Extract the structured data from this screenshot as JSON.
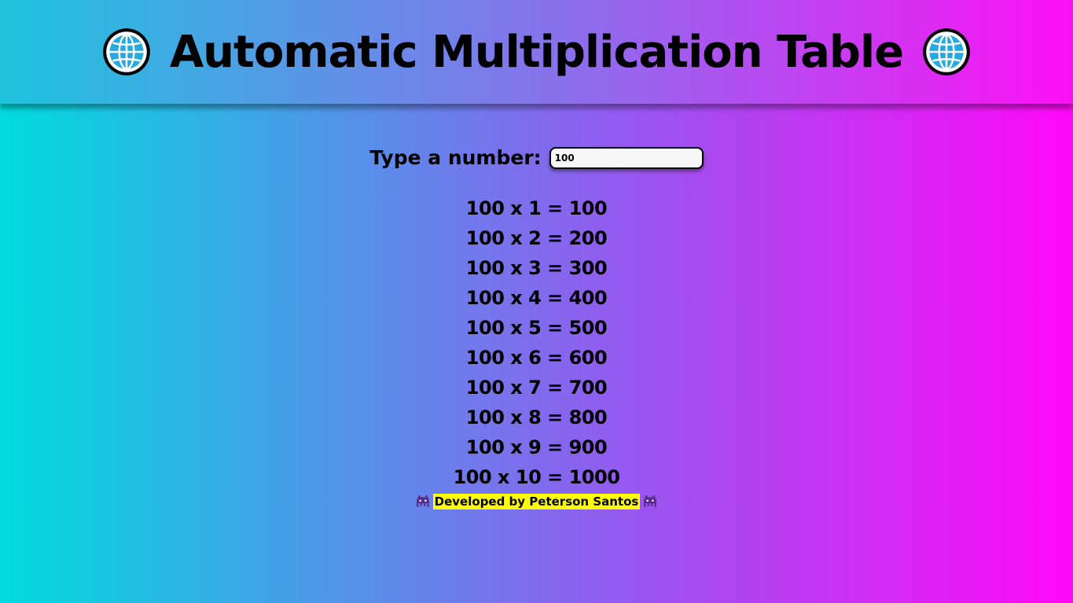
{
  "header": {
    "title": "Automatic Multiplication Table",
    "left_icon": "globe-icon",
    "right_icon": "globe-icon"
  },
  "form": {
    "label": "Type a number:",
    "value": "100"
  },
  "table": {
    "rows": [
      "100 x 1 = 100",
      "100 x 2 = 200",
      "100 x 3 = 300",
      "100 x 4 = 400",
      "100 x 5 = 500",
      "100 x 6 = 600",
      "100 x 7 = 700",
      "100 x 8 = 800",
      "100 x 9 = 900",
      "100 x 10 = 1000"
    ]
  },
  "footer": {
    "text": "Developed by Peterson Santos",
    "icon": "alien-monster-icon",
    "highlight_color": "#ffff00"
  },
  "colors": {
    "gradient_start": "#00dbdf",
    "gradient_end": "#ff08f8"
  }
}
